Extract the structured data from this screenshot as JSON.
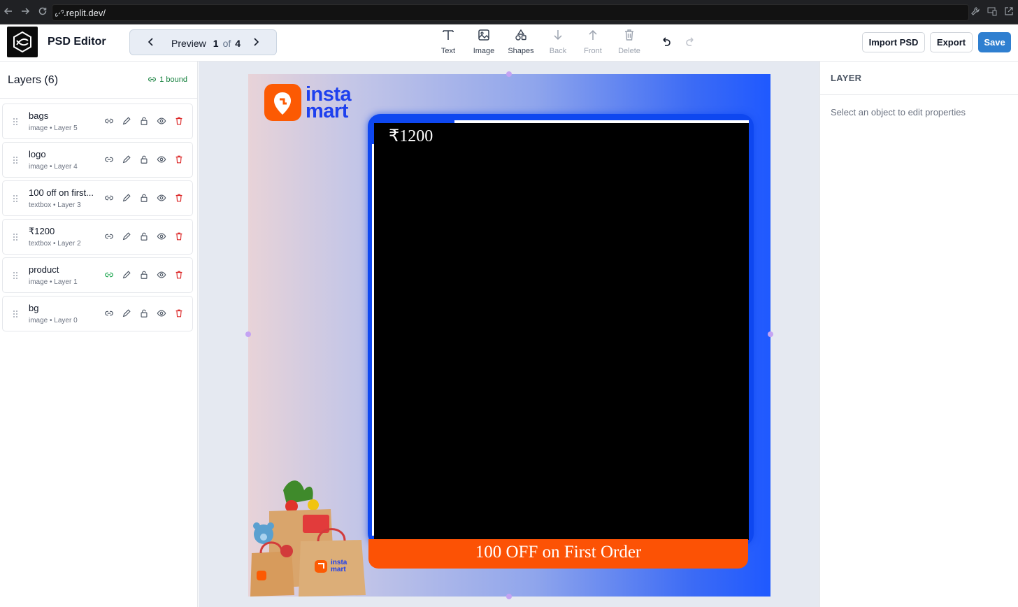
{
  "browser": {
    "url": ".replit.dev/"
  },
  "header": {
    "app_title": "PSD Editor",
    "preview": {
      "label": "Preview",
      "current": "1",
      "of": "of",
      "total": "4"
    },
    "tools": [
      {
        "label": "Text",
        "icon": "text-icon",
        "enabled": true
      },
      {
        "label": "Image",
        "icon": "image-icon",
        "enabled": true
      },
      {
        "label": "Shapes",
        "icon": "shapes-icon",
        "enabled": true
      },
      {
        "label": "Back",
        "icon": "arrow-down-icon",
        "enabled": false
      },
      {
        "label": "Front",
        "icon": "arrow-up-icon",
        "enabled": false
      },
      {
        "label": "Delete",
        "icon": "trash-icon",
        "enabled": false
      }
    ],
    "buttons": {
      "import": "Import PSD",
      "export": "Export",
      "save": "Save"
    }
  },
  "layers": {
    "title": "Layers (6)",
    "bound": "1 bound",
    "items": [
      {
        "name": "bags",
        "meta": "image • Layer 5",
        "bound": false
      },
      {
        "name": "logo",
        "meta": "image • Layer 4",
        "bound": false
      },
      {
        "name": "100 off on first...",
        "meta": "textbox • Layer 3",
        "bound": false
      },
      {
        "name": "₹1200",
        "meta": "textbox • Layer 2",
        "bound": false
      },
      {
        "name": "product",
        "meta": "image • Layer 1",
        "bound": true
      },
      {
        "name": "bg",
        "meta": "image • Layer 0",
        "bound": false
      }
    ]
  },
  "canvas": {
    "brand_line1": "insta",
    "brand_line2": "mart",
    "price": "₹1200",
    "offer": "100 OFF on First Order",
    "bag_brand_line1": "insta",
    "bag_brand_line2": "mart",
    "colors": {
      "brand_orange": "#fc5a03",
      "brand_blue": "#1e40ee",
      "frame_blue": "#0e47f0"
    }
  },
  "right_panel": {
    "title": "LAYER",
    "hint": "Select an object to edit properties"
  }
}
